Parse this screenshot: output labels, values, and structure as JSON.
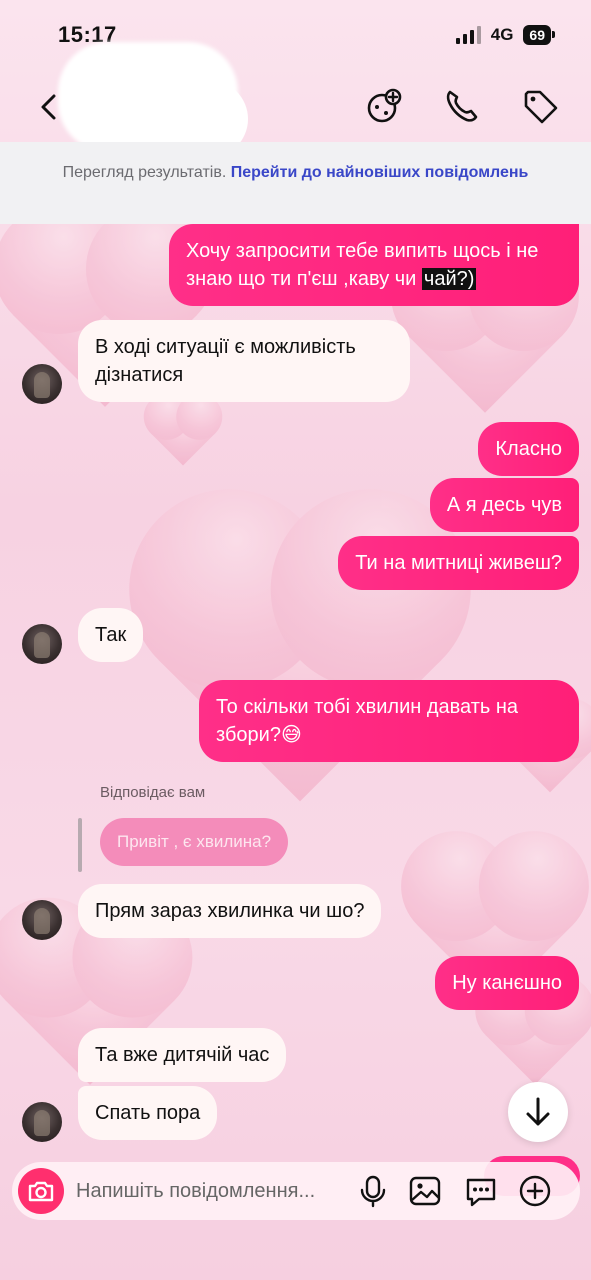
{
  "status_bar": {
    "time": "15:17",
    "network": "4G",
    "battery": "69"
  },
  "header": {
    "icons": [
      "back-icon",
      "games-icon",
      "call-icon",
      "tag-icon"
    ]
  },
  "banner": {
    "text": "Перегляд результатів.",
    "link": "Перейти до найновіших повідомлень"
  },
  "messages": [
    {
      "dir": "out",
      "text": "Хочу запросити тебе випить щось і не знаю що ти п'єш ,каву чи ",
      "highlight": "чай?)"
    },
    {
      "dir": "in",
      "text": "В ході ситуації є можливість дізнатися"
    },
    {
      "dir": "out",
      "text": "Класно"
    },
    {
      "dir": "out",
      "text": "А я десь чув"
    },
    {
      "dir": "out",
      "text": "Ти на митниці живеш?"
    },
    {
      "dir": "in",
      "text": "Так"
    },
    {
      "dir": "out",
      "text": "То скільки тобі хвилин давать на збори?😅"
    },
    {
      "dir": "in",
      "text": "Прям зараз хвилинка чи шо?"
    },
    {
      "dir": "out",
      "text": "Ну канєшно"
    },
    {
      "dir": "in",
      "text": "Та вже дитячій час"
    },
    {
      "dir": "in",
      "text": "Спать пора"
    }
  ],
  "reply": {
    "label": "Відповідає вам",
    "quoted": "Привіт , є хвилина?"
  },
  "composer": {
    "placeholder": "Напишіть повідомлення..."
  },
  "colors": {
    "outgoing": "#ff2f88",
    "incoming": "#fff6f5",
    "link": "#3a47c8"
  }
}
